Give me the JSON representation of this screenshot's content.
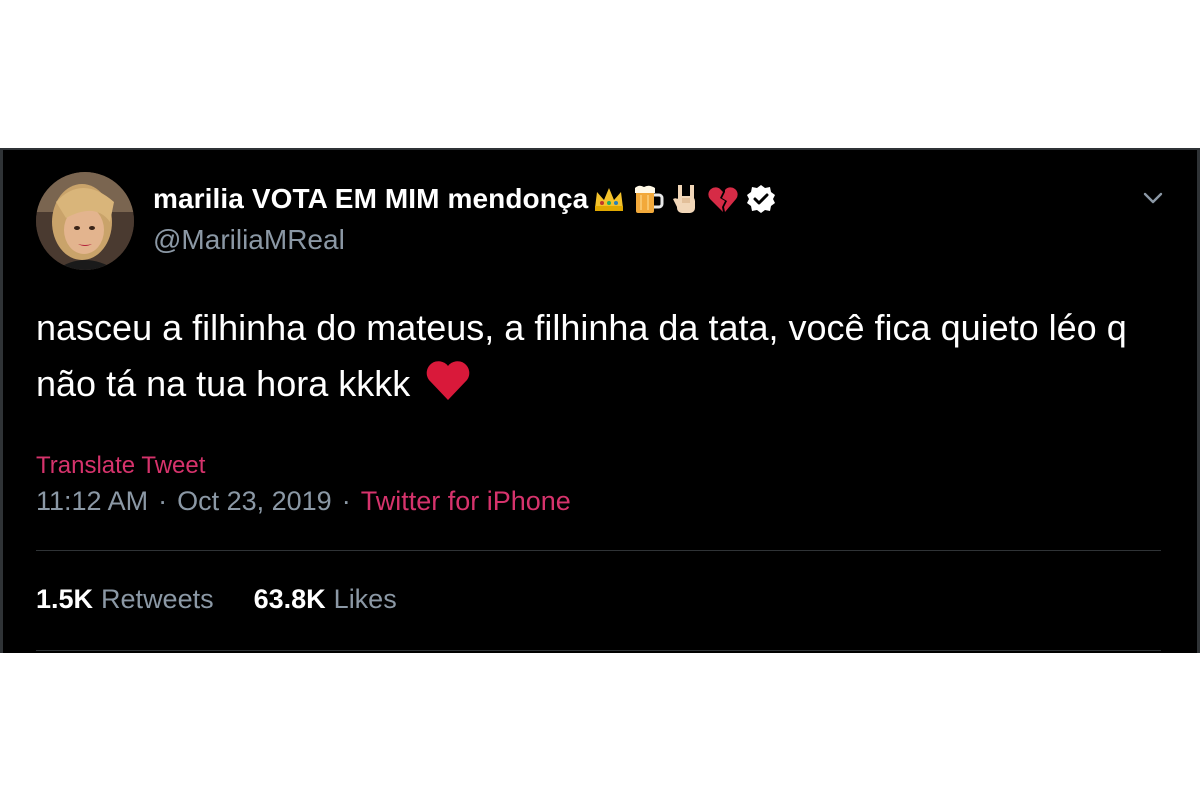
{
  "tweet": {
    "display_name": "marilia VOTA EM MIM mendonça",
    "name_emojis": [
      "crown-icon",
      "beer-mug-icon",
      "rock-on-hand-icon",
      "broken-heart-icon"
    ],
    "verified_icon": "verified-badge-icon",
    "handle": "@MariliaMReal",
    "menu_icon": "chevron-down-icon",
    "text": "nasceu a filhinha do mateus, a filhinha da tata, você fica quieto léo q não tá na tua hora kkkk",
    "text_emoji": "red-heart-icon",
    "translate_label": "Translate Tweet",
    "time": "11:12 AM",
    "separator": "·",
    "date": "Oct 23, 2019",
    "source": "Twitter for iPhone",
    "retweets_count": "1.5K",
    "retweets_label": "Retweets",
    "likes_count": "63.8K",
    "likes_label": "Likes"
  },
  "colors": {
    "background": "#000000",
    "text_primary": "#ffffff",
    "text_secondary": "#8b98a5",
    "accent": "#d6336c",
    "divider": "#2f3336",
    "heart": "#e0245e"
  }
}
